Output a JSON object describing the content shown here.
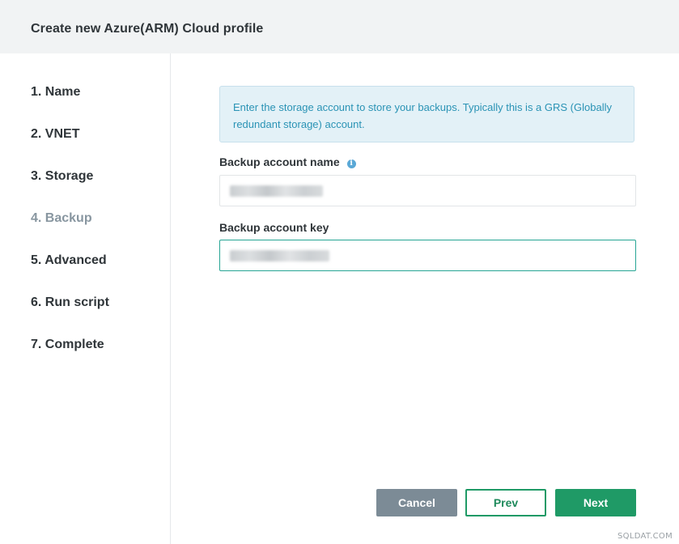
{
  "header": {
    "title": "Create new Azure(ARM) Cloud profile"
  },
  "steps": [
    {
      "label": "1. Name",
      "active": false
    },
    {
      "label": "2. VNET",
      "active": false
    },
    {
      "label": "3. Storage",
      "active": false
    },
    {
      "label": "4. Backup",
      "active": true
    },
    {
      "label": "5. Advanced",
      "active": false
    },
    {
      "label": "6. Run script",
      "active": false
    },
    {
      "label": "7. Complete",
      "active": false
    }
  ],
  "info": {
    "text": "Enter the storage account to store your backups. Typically this is a GRS (Globally redundant storage) account."
  },
  "form": {
    "account_name_label": "Backup account name",
    "account_key_label": "Backup account key"
  },
  "buttons": {
    "cancel": "Cancel",
    "prev": "Prev",
    "next": "Next"
  },
  "watermark": "SQLDAT.COM",
  "colors": {
    "header_bg": "#f1f3f4",
    "info_bg": "#e3f1f7",
    "info_text": "#2a93b5",
    "primary": "#1f9a66",
    "cancel": "#7c8b96",
    "focus_border": "#26a594"
  }
}
